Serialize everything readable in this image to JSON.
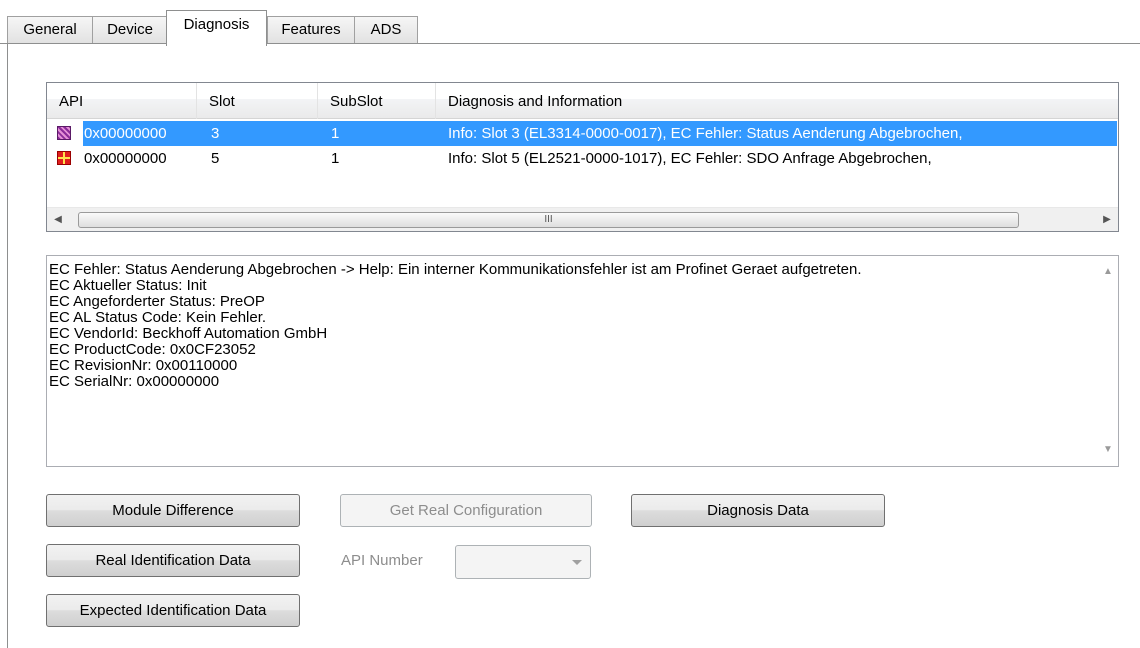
{
  "tabs": [
    "General",
    "Device",
    "Diagnosis",
    "Features",
    "ADS"
  ],
  "active_tab": "Diagnosis",
  "list": {
    "columns": [
      "API",
      "Slot",
      "SubSlot",
      "Diagnosis and Information"
    ],
    "rows": [
      {
        "icon": "module-warning-icon",
        "api": "0x00000000",
        "slot": "3",
        "subslot": "1",
        "info": "Info: Slot 3 (EL3314-0000-0017),  EC Fehler: Status Aenderung Abgebrochen,",
        "selected": true
      },
      {
        "icon": "module-error-icon",
        "api": "0x00000000",
        "slot": "5",
        "subslot": "1",
        "info": "Info: Slot 5 (EL2521-0000-1017),  EC Fehler: SDO Anfrage Abgebrochen,",
        "selected": false
      }
    ],
    "scroll_thumb_label": "III"
  },
  "details": {
    "lines": [
      "EC Fehler: Status Aenderung Abgebrochen -> Help: Ein interner Kommunikationsfehler ist am Profinet Geraet aufgetreten.",
      "EC Aktueller Status: Init",
      "EC Angeforderter Status: PreOP",
      "EC AL Status Code: Kein Fehler.",
      "EC VendorId: Beckhoff Automation GmbH",
      "EC ProductCode: 0x0CF23052",
      "EC RevisionNr: 0x00110000",
      "EC SerialNr: 0x00000000"
    ]
  },
  "buttons": {
    "module_difference": "Module Difference",
    "get_real_configuration": "Get Real Configuration",
    "diagnosis_data": "Diagnosis Data",
    "real_identification_data": "Real Identification Data",
    "expected_identification_data": "Expected Identification Data"
  },
  "api_number": {
    "label": "API Number",
    "value": ""
  },
  "colors": {
    "selection": "#3399ff"
  }
}
